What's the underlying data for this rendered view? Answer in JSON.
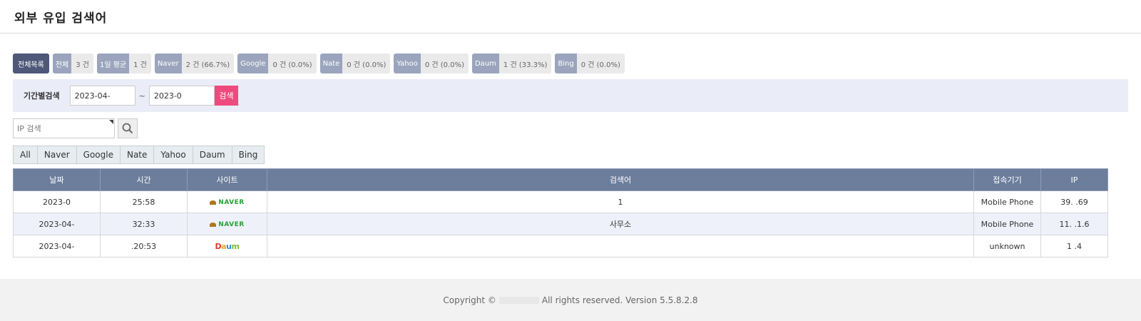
{
  "header": {
    "title": "외부 유입 검색어"
  },
  "stats": {
    "all_list": "전체목록",
    "items": [
      {
        "label": "전체",
        "value": "3 건"
      },
      {
        "label": "1일 평균",
        "value": "1 건"
      },
      {
        "label": "Naver",
        "value": "2 건 (66.7%)"
      },
      {
        "label": "Google",
        "value": "0 건 (0.0%)"
      },
      {
        "label": "Nate",
        "value": "0 건 (0.0%)"
      },
      {
        "label": "Yahoo",
        "value": "0 건 (0.0%)"
      },
      {
        "label": "Daum",
        "value": "1 건 (33.3%)"
      },
      {
        "label": "Bing",
        "value": "0 건 (0.0%)"
      }
    ]
  },
  "period": {
    "title": "기간별검색",
    "start_value": "2023-04-",
    "end_value": "2023-0",
    "separator": "~",
    "search_label": "검색"
  },
  "ip_search": {
    "placeholder": "IP 검색"
  },
  "site_tabs": [
    "All",
    "Naver",
    "Google",
    "Nate",
    "Yahoo",
    "Daum",
    "Bing"
  ],
  "table": {
    "headers": [
      "날짜",
      "시간",
      "사이트",
      "검색어",
      "접속기기",
      "IP"
    ],
    "rows": [
      {
        "date": "2023-0",
        "time": "25:58",
        "site": "NAVER",
        "keyword": "1",
        "device": "Mobile Phone",
        "ip": "39.   .69"
      },
      {
        "date": "2023-04-",
        "time": "32:33",
        "site": "NAVER",
        "keyword": "사무소",
        "device": "Mobile Phone",
        "ip": "11.   .1.6"
      },
      {
        "date": "2023-04-",
        "time": ".20:53",
        "site": "Daum",
        "keyword": "",
        "device": "unknown",
        "ip": "1   .4"
      }
    ]
  },
  "footer": {
    "copyright_prefix": "Copyright ©",
    "copyright_suffix": "All rights reserved. Version 5.5.8.2.8"
  },
  "colors": {
    "header_bar": "#6c7e9c",
    "stat_label": "#9aa5bd",
    "all_list": "#4e5878",
    "search_btn": "#ef4a7e",
    "naver_green": "#2aa034"
  }
}
